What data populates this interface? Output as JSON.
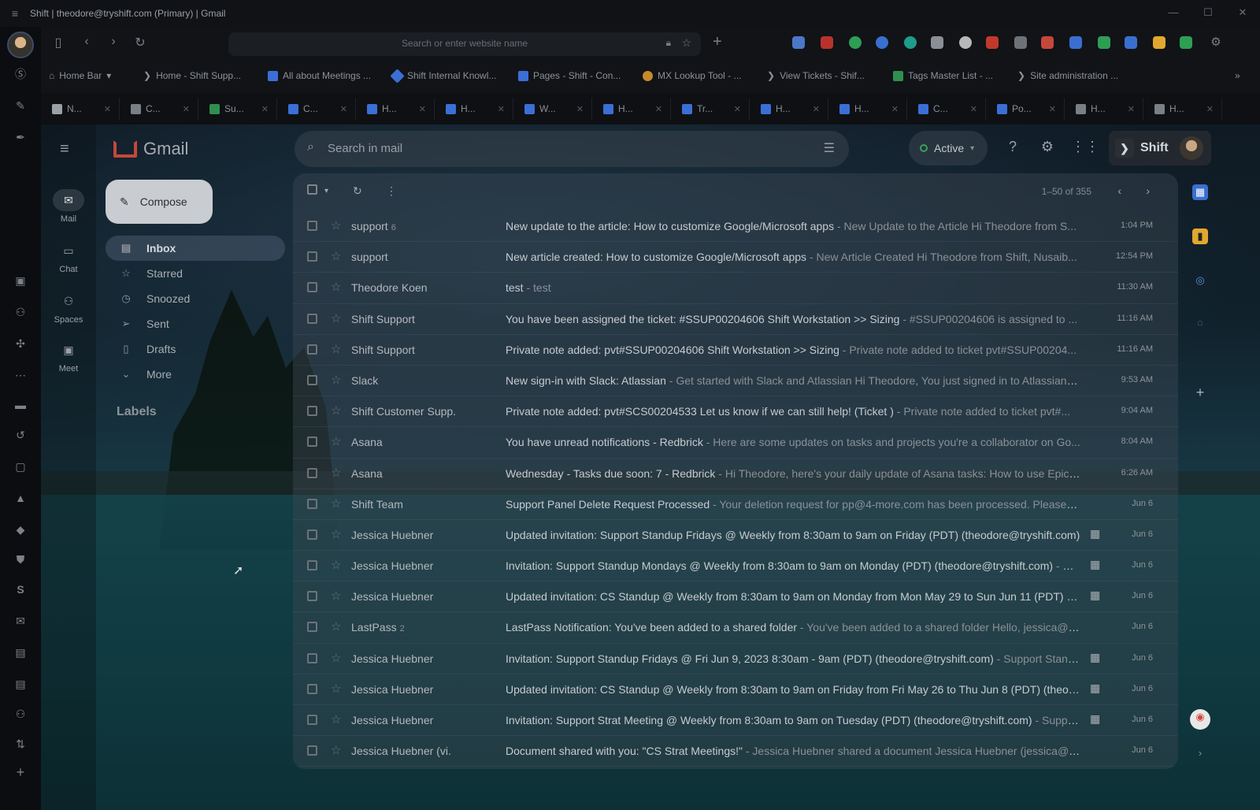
{
  "window": {
    "title": "Shift | theodore@tryshift.com (Primary) | Gmail",
    "menu_icon": "hamburger-icon",
    "controls": [
      "—",
      "☐",
      "✕"
    ]
  },
  "addressbar": {
    "placeholder": "Search or enter website name"
  },
  "bookmarks": [
    {
      "label": "Home Bar",
      "color": "#9aa0a6",
      "icon": "home-icon"
    },
    {
      "label": "Home - Shift Supp...",
      "color": "#7a7f86",
      "icon": "shift-icon"
    },
    {
      "label": "All about Meetings ...",
      "color": "#3b6fd6",
      "icon": "confluence-icon"
    },
    {
      "label": "Shift Internal Knowl...",
      "color": "#3b6fd6",
      "icon": "diamond-icon"
    },
    {
      "label": "Pages - Shift - Con...",
      "color": "#3b6fd6",
      "icon": "confluence-icon"
    },
    {
      "label": "MX Lookup Tool - ...",
      "color": "#c78a2a",
      "icon": "mx-icon"
    },
    {
      "label": "View Tickets - Shif...",
      "color": "#7a7f86",
      "icon": "shift-icon"
    },
    {
      "label": "Tags Master List - ...",
      "color": "#2f8f4e",
      "icon": "sheets-icon"
    },
    {
      "label": "Site administration ...",
      "color": "#7a7f86",
      "icon": "shift-icon"
    }
  ],
  "tabs": [
    {
      "label": "N...",
      "color": "#9aa0a6"
    },
    {
      "label": "C...",
      "color": "#7a7f86"
    },
    {
      "label": "Su...",
      "color": "#2f8f4e"
    },
    {
      "label": "C...",
      "color": "#3b6fd6"
    },
    {
      "label": "H...",
      "color": "#3b6fd6"
    },
    {
      "label": "H...",
      "color": "#3b6fd6"
    },
    {
      "label": "W...",
      "color": "#3b6fd6"
    },
    {
      "label": "H...",
      "color": "#3b6fd6"
    },
    {
      "label": "Tr...",
      "color": "#3b6fd6"
    },
    {
      "label": "H...",
      "color": "#3b6fd6"
    },
    {
      "label": "H...",
      "color": "#3b6fd6"
    },
    {
      "label": "C...",
      "color": "#3b6fd6"
    },
    {
      "label": "Po...",
      "color": "#3b6fd6"
    },
    {
      "label": "H...",
      "color": "#7a7f86"
    },
    {
      "label": "H...",
      "color": "#7a7f86"
    }
  ],
  "gmail": {
    "logo": "Gmail",
    "apps": [
      {
        "label": "Mail",
        "icon": "mail-icon"
      },
      {
        "label": "Chat",
        "icon": "chat-icon"
      },
      {
        "label": "Spaces",
        "icon": "spaces-icon"
      },
      {
        "label": "Meet",
        "icon": "meet-icon"
      }
    ],
    "compose": "Compose",
    "nav": [
      {
        "label": "Inbox",
        "icon": "inbox-icon"
      },
      {
        "label": "Starred",
        "icon": "star-icon"
      },
      {
        "label": "Snoozed",
        "icon": "clock-icon"
      },
      {
        "label": "Sent",
        "icon": "send-icon"
      },
      {
        "label": "Drafts",
        "icon": "draft-icon"
      },
      {
        "label": "More",
        "icon": "chevron-down-icon"
      }
    ],
    "labels_heading": "Labels",
    "search_placeholder": "Search in mail",
    "status": "Active",
    "shift_brand": "Shift",
    "pagination": "1–50 of 355",
    "emails": [
      {
        "sender": "support",
        "count": "6",
        "subject": "New update to the article: How to customize Google/Microsoft apps",
        "snippet": " - New Update to the Article Hi Theodore from S...",
        "time": "1:04 PM",
        "cal": false
      },
      {
        "sender": "support",
        "count": "",
        "subject": "New article created: How to customize Google/Microsoft apps",
        "snippet": " - New Article Created Hi Theodore from Shift, Nusaib...",
        "time": "12:54 PM",
        "cal": false
      },
      {
        "sender": "Theodore Koen",
        "count": "",
        "subject": "test",
        "snippet": " - test",
        "time": "11:30 AM",
        "cal": false
      },
      {
        "sender": "Shift Support",
        "count": "",
        "subject": "You have been assigned the ticket: #SSUP00204606 Shift Workstation >> Sizing",
        "snippet": " - #SSUP00204606 is assigned to ...",
        "time": "11:16 AM",
        "cal": false
      },
      {
        "sender": "Shift Support",
        "count": "",
        "subject": "Private note added: pvt#SSUP00204606 Shift Workstation >> Sizing",
        "snippet": " - Private note added to ticket pvt#SSUP00204...",
        "time": "11:16 AM",
        "cal": false
      },
      {
        "sender": "Slack",
        "count": "",
        "subject": "New sign-in with Slack: Atlassian",
        "snippet": " - Get started with Slack and Atlassian Hi Theodore, You just signed in to Atlassian u...",
        "time": "9:53 AM",
        "cal": false
      },
      {
        "sender": "Shift Customer Supp.",
        "count": "",
        "subject": "Private note added: pvt#SCS00204533 Let us know if we can still help! (Ticket )",
        "snippet": " - Private note added to ticket pvt#...",
        "time": "9:04 AM",
        "cal": false
      },
      {
        "sender": "Asana",
        "count": "",
        "subject": "You have unread notifications - Redbrick",
        "snippet": " - Here are some updates on tasks and projects you're a collaborator on Go...",
        "time": "8:04 AM",
        "cal": false
      },
      {
        "sender": "Asana",
        "count": "",
        "subject": "Wednesday - Tasks due soon: 7 - Redbrick",
        "snippet": " - Hi Theodore, here's your daily update of Asana tasks: How to use Epic ...",
        "time": "6:26 AM",
        "cal": false
      },
      {
        "sender": "Shift Team",
        "count": "",
        "subject": "Support Panel Delete Request Processed",
        "snippet": " - Your deletion request for pp@4-more.com has been processed. Please l...",
        "time": "Jun 6",
        "cal": false
      },
      {
        "sender": "Jessica Huebner",
        "count": "",
        "subject": "Updated invitation: Support Standup Fridays @ Weekly from 8:30am to 9am on Friday (PDT) (theodore@tryshift.com)",
        "snippet": "",
        "time": "Jun 6",
        "cal": true
      },
      {
        "sender": "Jessica Huebner",
        "count": "",
        "subject": "Invitation: Support Standup Mondays @ Weekly from 8:30am to 9am on Monday (PDT) (theodore@tryshift.com)",
        "snippet": " - Su...",
        "time": "Jun 6",
        "cal": true
      },
      {
        "sender": "Jessica Huebner",
        "count": "",
        "subject": "Updated invitation: CS Standup @ Weekly from 8:30am to 9am on Monday from Mon May 29 to Sun Jun 11 (PDT) (the...",
        "snippet": "",
        "time": "Jun 6",
        "cal": true
      },
      {
        "sender": "LastPass",
        "count": "2",
        "subject": "LastPass Notification: You've been added to a shared folder",
        "snippet": " - You've been added to a shared folder Hello, jessica@t...",
        "time": "Jun 6",
        "cal": false
      },
      {
        "sender": "Jessica Huebner",
        "count": "",
        "subject": "Invitation: Support Standup Fridays @ Fri Jun 9, 2023 8:30am - 9am (PDT) (theodore@tryshift.com)",
        "snippet": " - Support Stand...",
        "time": "Jun 6",
        "cal": true
      },
      {
        "sender": "Jessica Huebner",
        "count": "",
        "subject": "Updated invitation: CS Standup @ Weekly from 8:30am to 9am on Friday from Fri May 26 to Thu Jun 8 (PDT) (theodo...",
        "snippet": "",
        "time": "Jun 6",
        "cal": true
      },
      {
        "sender": "Jessica Huebner",
        "count": "",
        "subject": "Invitation: Support Strat Meeting @ Weekly from 8:30am to 9am on Tuesday (PDT) (theodore@tryshift.com)",
        "snippet": " - Suppo...",
        "time": "Jun 6",
        "cal": true
      },
      {
        "sender": "Jessica Huebner (vi.",
        "count": "",
        "subject": "Document shared with you: \"CS Strat Meetings!\"",
        "snippet": " - Jessica Huebner shared a document Jessica Huebner (jessica@t...",
        "time": "Jun 6",
        "cal": false
      }
    ]
  }
}
